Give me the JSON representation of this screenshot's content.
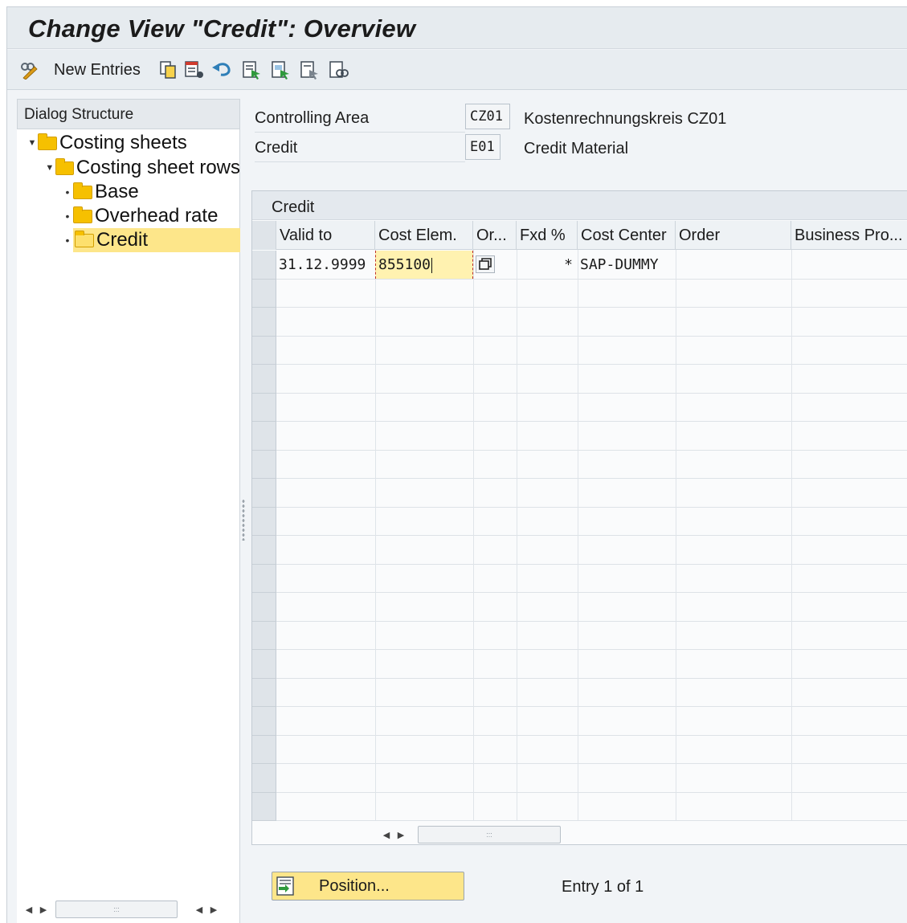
{
  "window": {
    "title": "Change View \"Credit\": Overview"
  },
  "toolbar": {
    "new_entries_label": "New Entries",
    "icons": [
      "display-change-icon",
      "copy-icon",
      "delete-icon",
      "undo-icon",
      "select-all-icon",
      "select-block-icon",
      "deselect-all-icon",
      "print-preview-icon"
    ]
  },
  "dialog_structure": {
    "header": "Dialog Structure",
    "items": [
      {
        "label": "Costing sheets",
        "level": 0,
        "expanded": true
      },
      {
        "label": "Costing sheet rows",
        "level": 1,
        "expanded": true
      },
      {
        "label": "Base",
        "level": 2
      },
      {
        "label": "Overhead rate",
        "level": 2
      },
      {
        "label": "Credit",
        "level": 2,
        "selected": true
      }
    ]
  },
  "header_fields": {
    "controlling_area": {
      "label": "Controlling Area",
      "value": "CZ01",
      "text": "Kostenrechnungskreis CZ01"
    },
    "credit": {
      "label": "Credit",
      "value": "E01",
      "text": "Credit Material"
    }
  },
  "table": {
    "title": "Credit",
    "columns": [
      "Valid to",
      "Cost Elem.",
      "Or...",
      "Fxd %",
      "Cost Center",
      "Order",
      "Business Pro..."
    ],
    "rows": [
      {
        "valid_to": "31.12.9999",
        "cost_elem": "855100",
        "or": "",
        "fxd": "*",
        "cost_center": "SAP-DUMMY",
        "order": "",
        "business_process": ""
      }
    ]
  },
  "footer": {
    "position_button": "Position...",
    "entry_info": "Entry 1 of 1"
  },
  "colors": {
    "folder": "#f6c000",
    "selection": "#fde68a",
    "active_cell": "#fff2b0"
  }
}
